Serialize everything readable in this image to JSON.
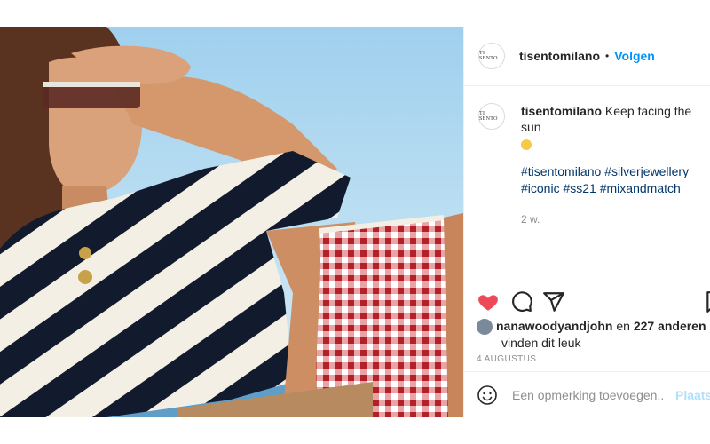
{
  "header": {
    "avatar_text": "TI SENTO",
    "username": "tisentomilano",
    "separator": "•",
    "follow_label": "Volgen"
  },
  "caption": {
    "username": "tisentomilano",
    "text": "Keep facing the sun",
    "emoji": "sun-smile-emoji",
    "hashtags": [
      "#tisentomilano",
      "#silverjewellery",
      "#iconic",
      "#ss21",
      "#mixandmatch"
    ],
    "age": "2 w."
  },
  "actions": {
    "icons": [
      "heart-icon",
      "comment-icon",
      "share-icon",
      "save-icon"
    ],
    "heart_color": "#ed4956"
  },
  "likes": {
    "user": "nanawoodyandjohn",
    "connector": "en",
    "others": "227 anderen",
    "suffix": "vinden dit leuk"
  },
  "date": "4 AUGUSTUS",
  "comment": {
    "placeholder": "Een opmerking toevoegen...",
    "post_label": "Plaats"
  },
  "colors": {
    "link": "#0095f6",
    "hashtag": "#00376b",
    "muted": "#8e8e8e"
  }
}
